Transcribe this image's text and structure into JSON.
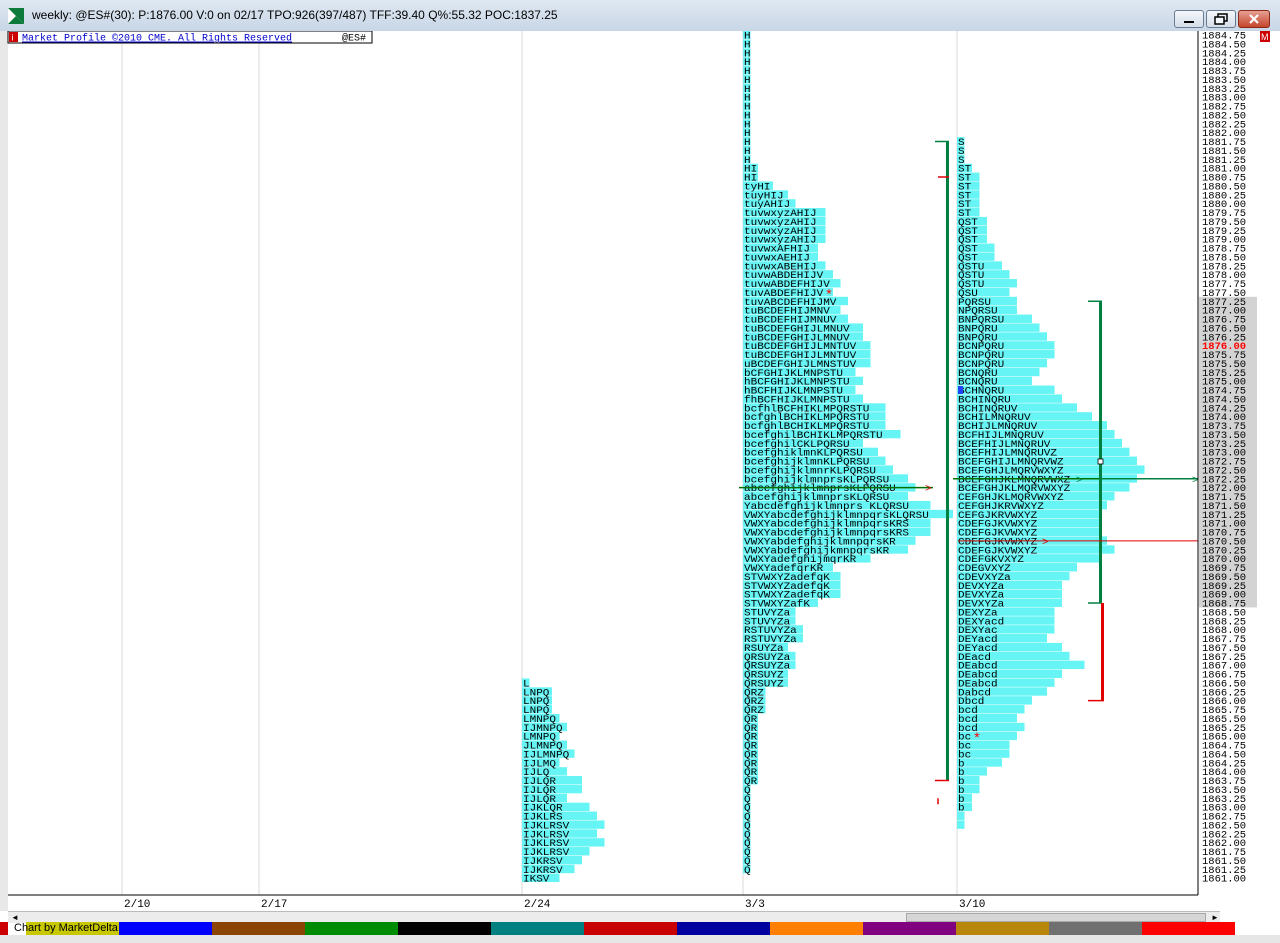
{
  "window": {
    "title": "weekly: @ES#(30): P:1876.00 V:0 on 02/17 TPO:926(397/487) TFF:39.40 Q%:55.32 POC:1837.25",
    "header_label": "Market Profile ©2010 CME. All Rights Reserved",
    "symbol": "@ES#",
    "minimize_icon": "minimize-icon",
    "restore_icon": "restore-icon",
    "close_icon": "close-icon"
  },
  "footer": {
    "label": "Chart by MarketDelta",
    "colors": [
      "#c8c800",
      "#0000ff",
      "#8b4500",
      "#008c00",
      "#000000",
      "#008080",
      "#c80000",
      "#0000a0",
      "#ff8000",
      "#800080",
      "#b8860b",
      "#707070",
      "#ff0000"
    ]
  },
  "chart_data": {
    "type": "table",
    "title": "",
    "price_axis": {
      "max": 1884.75,
      "min": 1861.0,
      "step": 0.25,
      "label_step": 0.25,
      "labels_from": 1884.75,
      "labels_to": 1861.0,
      "last_price": 1876.0,
      "value_area_shaded": [
        1877.25,
        1868.75
      ]
    },
    "dates": [
      "2/10",
      "2/17",
      "2/24",
      "3/3",
      "3/10"
    ],
    "colors": {
      "tpo_text": "#000000",
      "histogram": "#66f4f4",
      "value_area_line": "#008040",
      "range_ext_line": "#e00000",
      "poc_line": "#007000",
      "last_price": "#ff0000"
    },
    "profiles": [
      {
        "date": "2/24",
        "top": 1866.5,
        "rows": [
          "L",
          "LNPQ",
          "LNPQ",
          "LNPQ",
          "LMNPQ",
          "IJMNPQ",
          "LMNPQ",
          "JLMNPQ",
          "IJLMNPQ",
          "IJLMQ",
          "IJLQ",
          "IJLQR",
          "IJLQR",
          "IJLQR",
          "IJKLQR",
          "IJKLRS",
          "IJKLRSV",
          "IJKLRSV",
          "IJKLRSV",
          "IJKLRSV",
          "IJKRSV",
          "IJKRSV",
          "IKSV"
        ],
        "hist": [
          1,
          4,
          4,
          4,
          5,
          6,
          5,
          6,
          7,
          5,
          6,
          8,
          8,
          6,
          9,
          10,
          11,
          10,
          11,
          9,
          8,
          7,
          5
        ]
      },
      {
        "date": "3/3",
        "top": 1884.75,
        "rows": [
          "H",
          "H",
          "H",
          "H",
          "H",
          "H",
          "H",
          "H",
          "H",
          "H",
          "H",
          "H",
          "H",
          "H",
          "H",
          "HI",
          "HI",
          "tyHI",
          "tuyHIJ",
          "tuyAHIJ",
          "tuvwxyzAHIJ",
          "tuvwxyzAHIJ",
          "tuvwxyzAHIJ",
          "tuvwxyzAHIJ",
          "tuvwxAFHIJ",
          "tuvwxAEHIJ",
          "tuvwxABEHIJ",
          "tuvwABDEHIJV",
          "tuvwABDEFHIJV",
          "tuvABDEFHIJV",
          "tuvABCDEFHIJMV",
          "tuBCDEFHIJMNV",
          "tuBCDEFHIJMNUV",
          "tuBCDEFGHIJLMNUV",
          "tuBCDEFGHIJLMNUV",
          "tuBCDEFGHIJLMNTUV",
          "tuBCDEFGHIJLMNTUV",
          "uBCDEFGHIJLMNSTUV",
          "bCFGHIJKLMNPSTU",
          "hBCFGHIJKLMNPSTU",
          "hBCFHIJKLMNPSTU",
          "fhBCFHIJKLMNPSTU",
          "bcfhlBCFHIKLMPQRSTU",
          "bcfghlBCHIKLMPQRSTU",
          "bcfghlBCHIKLMPQRSTU",
          "bcefghilBCHIKLMPQRSTU",
          "bcefghilCKLPQRSU",
          "bcefghiklmnKLPQRSU",
          "bcefghijklmnKLPQRSU",
          "bcefghijklmnrKLPQRSU",
          "bcefghijklmnprsKLPQRSU",
          "abcefghijklmnprsKLPQRSU",
          "abcefghijklmnprsKLQRSU",
          "Yabcdefghijklmnprs KLQRSU",
          "VWXYabcdefghijklmnpqrsKLQRSU",
          "VWXYabcdefghijklmnpqrsKRS",
          "VWXYabcdefghijklmnpqrsKRS",
          "VWXYabdefghijklmnpqrsKR",
          "VWXYabdefghijkmnpqrsKR",
          "VWXYadefghijmqrKR",
          "VWXYadefqrKR",
          "STVWXYZadefqK",
          "STVWXYZadefqK",
          "STVWXYZadefqK",
          "STVWXYZafK",
          "STUVYZa",
          "STUVYZa",
          "RSTUVYZa",
          "RSTUVYZa",
          "RSUYZa",
          "QRSUYZa",
          "QRSUYZa",
          "QRSUYZ",
          "QRSUYZ",
          "QRZ",
          "QRZ",
          "QRZ",
          "QR",
          "QR",
          "QR",
          "QR",
          "QR",
          "QR",
          "QR",
          "QR",
          "Q",
          "Q",
          "Q",
          "Q",
          "Q",
          "Q",
          "Q",
          "Q",
          "Q",
          "Q"
        ],
        "hist": [
          1,
          1,
          1,
          1,
          1,
          1,
          1,
          1,
          1,
          1,
          1,
          1,
          1,
          1,
          1,
          2,
          2,
          4,
          6,
          7,
          11,
          11,
          11,
          11,
          10,
          10,
          11,
          12,
          13,
          12,
          14,
          13,
          14,
          16,
          16,
          17,
          17,
          17,
          15,
          16,
          15,
          16,
          19,
          19,
          19,
          21,
          16,
          18,
          19,
          20,
          22,
          23,
          22,
          25,
          28,
          25,
          25,
          23,
          22,
          17,
          12,
          13,
          13,
          13,
          10,
          7,
          7,
          8,
          8,
          6,
          7,
          7,
          6,
          6,
          3,
          3,
          3,
          2,
          2,
          2,
          2,
          2,
          2,
          2,
          2,
          1,
          1,
          1,
          1,
          1,
          1,
          1,
          1,
          1,
          1
        ],
        "poc": 1872.0,
        "tail_marker": 1877.5
      },
      {
        "date": "3/10",
        "top": 1881.75,
        "rows": [
          "S",
          "S",
          "S",
          "ST",
          "ST",
          "ST",
          "ST",
          "ST",
          "ST",
          "QST",
          "QST",
          "QST",
          "QST",
          "QST",
          "QSTU",
          "QSTU",
          "QSTU",
          "QSU",
          "PQRSU",
          "NPQRSU",
          "BNPQRSU",
          "BNPQRU",
          "BNPQRU",
          "BCNPQRU",
          "BCNPQRU",
          "BCNPQRU",
          "BCNQRU",
          "BCNQRU",
          "BCHNQRU",
          "BCHINQRU",
          "BCHINQRUV",
          "BCHILMNQRUV",
          "BCHIJLMNQRUV",
          "BCFHIJLMNQRUV",
          "BCEFHIJLMNQRUV",
          "BCEFHIJLMNQRUVZ",
          "BCEFGHIJLMNQRVWZ",
          "BCEFGHJLMQRVWXYZ",
          "BCEFGHJKLMNQRVWXZ",
          "BCEFGHJKLMQRVWXYZ",
          "CEFGHJKLMQRVWXYZ",
          "CEFGHJKRVWXYZ",
          "CEFGJKRVWXYZ",
          "CDEFGJKVWXYZ",
          "CDEFGJKVWXYZ",
          "CDEFGJKVWXYZ",
          "CDEFGJKVWXYZ",
          "CDEFGKVXYZ",
          "CDEGVXYZ",
          "CDEVXYZa",
          "DEVXYZa",
          "DEVXYZa",
          "DEVXYZa",
          "DEXYZa",
          "DEXYacd",
          "DEXYac",
          "DEYacd",
          "DEYacd",
          "DEacd",
          "DEabcd",
          "DEabcd",
          "DEabcd",
          "Dabcd",
          "Dbcd",
          "bcd",
          "bcd",
          "bcd",
          "bc",
          "bc",
          "bc",
          "b",
          "b",
          "b",
          "b",
          "b",
          "b"
        ],
        "hist": [
          1,
          1,
          1,
          2,
          3,
          3,
          3,
          3,
          3,
          4,
          4,
          4,
          5,
          5,
          6,
          7,
          8,
          7,
          8,
          8,
          10,
          11,
          12,
          13,
          13,
          12,
          11,
          10,
          13,
          14,
          16,
          18,
          20,
          21,
          22,
          23,
          24,
          25,
          24,
          23,
          21,
          20,
          19,
          19,
          19,
          20,
          21,
          19,
          16,
          15,
          14,
          14,
          14,
          13,
          13,
          13,
          12,
          14,
          15,
          17,
          14,
          13,
          12,
          10,
          9,
          8,
          9,
          8,
          7,
          7,
          6,
          4,
          3,
          3,
          2,
          2,
          1,
          1
        ],
        "poc": 1872.25,
        "tail_marker": 1865.0,
        "open_marker": 1874.75
      }
    ]
  }
}
